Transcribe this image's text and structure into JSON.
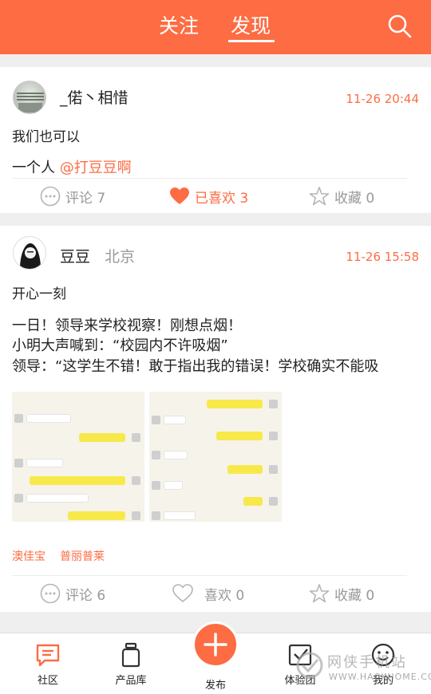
{
  "header": {
    "tabs": [
      {
        "label": "关注",
        "active": false
      },
      {
        "label": "发现",
        "active": true
      }
    ],
    "icon": "search-icon",
    "color": "#fd6c43"
  },
  "posts": [
    {
      "username": "_偌丶相惜",
      "location": "",
      "time": "11-26 20:44",
      "lines": [
        "我们也可以"
      ],
      "body_prefix": "一个人 ",
      "mention": "@打豆豆啊",
      "comments": "评论 7",
      "likes": "已喜欢 3",
      "favorites": "收藏 0"
    },
    {
      "username": "豆豆",
      "location": "北京",
      "time": "11-26 15:58",
      "lines": [
        "开心一刻",
        "一日！领导来学校视察！刚想点烟！",
        "小明大声喊到：“校园内不许吸烟”",
        "领导：“这学生不错！敢于指出我的错误！学校确实不能吸"
      ],
      "tags": [
        "澳佳宝",
        "普丽普莱"
      ],
      "comments": "评论 6",
      "likes": "喜欢 0",
      "favorites": "收藏 0"
    }
  ],
  "nav": [
    {
      "label": "社区",
      "icon": "chat-bubble-icon",
      "active": true
    },
    {
      "label": "产品库",
      "icon": "bottle-icon"
    },
    {
      "label": "发布",
      "icon": "plus-icon"
    },
    {
      "label": "体验团",
      "icon": "checkbox-icon"
    },
    {
      "label": "我的",
      "icon": "smiley-icon"
    }
  ],
  "watermark": {
    "cn": "网侠手机站",
    "url": "WWW.HACKHOME.COM"
  }
}
